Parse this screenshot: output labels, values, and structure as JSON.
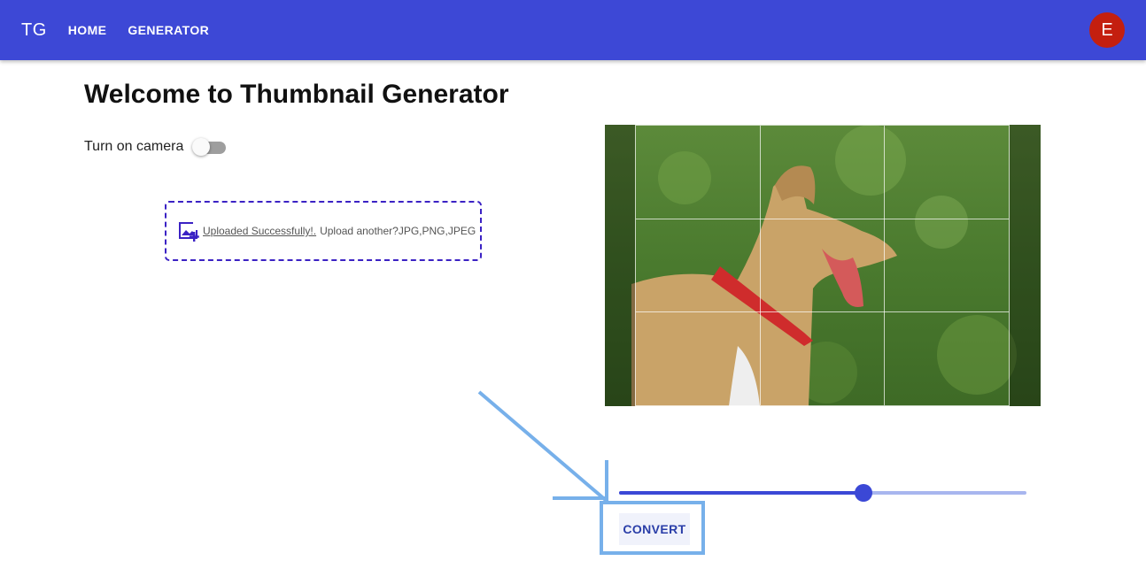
{
  "appbar": {
    "brand": "TG",
    "nav": [
      "HOME",
      "GENERATOR"
    ],
    "avatar_letter": "E",
    "color": "#3d48d6",
    "avatar_color": "#c41f0f"
  },
  "main": {
    "title": "Welcome to Thumbnail Generator",
    "camera_label": "Turn on camera",
    "camera_on": false
  },
  "upload": {
    "icon": "add-photo-icon",
    "success_text": "Uploaded Successfully!.",
    "hint_text": "Upload another?JPG,PNG,JPEG"
  },
  "preview": {
    "image": "dog-photo",
    "crop_grid": "3x3"
  },
  "slider": {
    "value": 0.6
  },
  "convert": {
    "label": "CONVERT"
  }
}
